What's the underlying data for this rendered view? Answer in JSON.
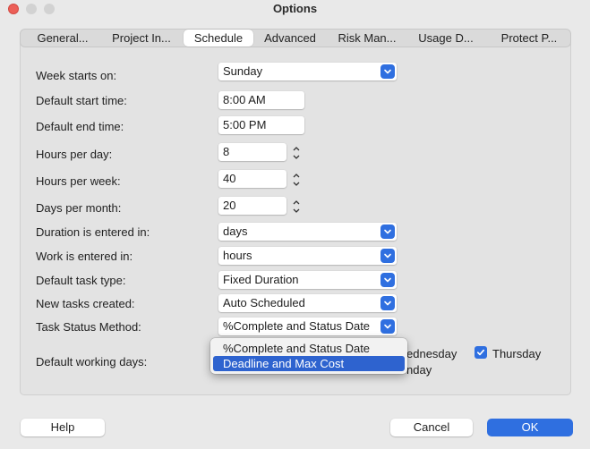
{
  "window": {
    "title": "Options"
  },
  "tabs": [
    {
      "label": "General..."
    },
    {
      "label": "Project In..."
    },
    {
      "label": "Schedule"
    },
    {
      "label": "Advanced"
    },
    {
      "label": "Risk Man..."
    },
    {
      "label": "Usage D..."
    },
    {
      "label": "Protect P..."
    }
  ],
  "active_tab": "Schedule",
  "form": {
    "week_starts_on": {
      "label": "Week starts on:",
      "value": "Sunday"
    },
    "default_start_time": {
      "label": "Default start time:",
      "value": "8:00 AM"
    },
    "default_end_time": {
      "label": "Default end time:",
      "value": "5:00 PM"
    },
    "hours_per_day": {
      "label": "Hours per day:",
      "value": "8"
    },
    "hours_per_week": {
      "label": "Hours per week:",
      "value": "40"
    },
    "days_per_month": {
      "label": "Days per month:",
      "value": "20"
    },
    "duration_entered_in": {
      "label": "Duration is entered in:",
      "value": "days"
    },
    "work_entered_in": {
      "label": "Work is entered in:",
      "value": "hours"
    },
    "default_task_type": {
      "label": "Default task type:",
      "value": "Fixed Duration"
    },
    "new_tasks_created": {
      "label": "New tasks created:",
      "value": "Auto Scheduled"
    },
    "task_status_method": {
      "label": "Task Status Method:",
      "value": "%Complete and Status Date",
      "options": [
        "%Complete and Status Date",
        "Deadline and Max Cost"
      ],
      "highlighted": "Deadline and Max Cost"
    },
    "default_working_days": {
      "label": "Default working days:",
      "partial_wednesday": "ednesday",
      "partial_sunday": "nday",
      "thursday": {
        "label": "Thursday",
        "checked": true
      }
    }
  },
  "buttons": {
    "help": "Help",
    "cancel": "Cancel",
    "ok": "OK"
  },
  "colors": {
    "accent": "#2f6fe0",
    "highlight": "#2e63cf",
    "close": "#ec5f57"
  }
}
